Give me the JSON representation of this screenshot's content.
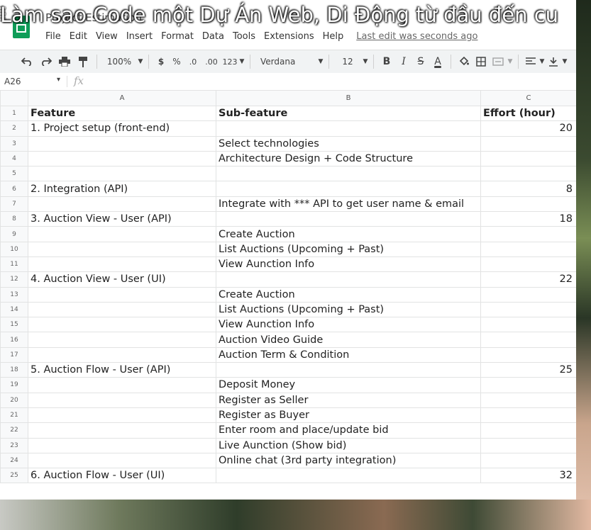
{
  "video": {
    "title": "Làm sao Code một Dự Án Web, Di Động từ đầu đến cu"
  },
  "doc": {
    "title": "Project Estimation"
  },
  "menu": [
    "File",
    "Edit",
    "View",
    "Insert",
    "Format",
    "Data",
    "Tools",
    "Extensions",
    "Help"
  ],
  "last_edit": "Last edit was seconds ago",
  "toolbar": {
    "zoom": "100%",
    "currency": "$",
    "percent": "%",
    "dec_less": ".0",
    "dec_more": ".00",
    "number_format": "123",
    "font": "Verdana",
    "font_size": "12",
    "bold": "B",
    "italic": "I",
    "strike": "S",
    "text_color": "A"
  },
  "formula_bar": {
    "cell_ref": "A26",
    "fx": "fx"
  },
  "columns": [
    "A",
    "B",
    "C"
  ],
  "rows": [
    {
      "n": "1",
      "a": "Feature",
      "b": "Sub-feature",
      "c": "Effort (hour)"
    },
    {
      "n": "2",
      "a": "1. Project setup (front-end)",
      "b": "",
      "c": "20"
    },
    {
      "n": "3",
      "a": "",
      "b": "Select technologies",
      "c": ""
    },
    {
      "n": "4",
      "a": "",
      "b": "Architecture Design + Code Structure",
      "c": ""
    },
    {
      "n": "5",
      "a": "",
      "b": "",
      "c": ""
    },
    {
      "n": "6",
      "a": "2. Integration (API)",
      "b": "",
      "c": "8"
    },
    {
      "n": "7",
      "a": "",
      "b": "Integrate with *** API to get user name & email",
      "c": ""
    },
    {
      "n": "8",
      "a": "3. Auction View - User (API)",
      "b": "",
      "c": "18"
    },
    {
      "n": "9",
      "a": "",
      "b": "Create Auction",
      "c": ""
    },
    {
      "n": "10",
      "a": "",
      "b": "List Auctions (Upcoming + Past)",
      "c": ""
    },
    {
      "n": "11",
      "a": "",
      "b": "View Aunction Info",
      "c": ""
    },
    {
      "n": "12",
      "a": "4. Auction View - User (UI)",
      "b": "",
      "c": "22"
    },
    {
      "n": "13",
      "a": "",
      "b": "Create Auction",
      "c": ""
    },
    {
      "n": "14",
      "a": "",
      "b": "List Auctions (Upcoming + Past)",
      "c": ""
    },
    {
      "n": "15",
      "a": "",
      "b": "View Aunction Info",
      "c": ""
    },
    {
      "n": "16",
      "a": "",
      "b": "Auction Video Guide",
      "c": ""
    },
    {
      "n": "17",
      "a": "",
      "b": "Auction Term & Condition",
      "c": ""
    },
    {
      "n": "18",
      "a": "5. Auction Flow - User (API)",
      "b": "",
      "c": "25"
    },
    {
      "n": "19",
      "a": "",
      "b": "Deposit Money",
      "c": ""
    },
    {
      "n": "20",
      "a": "",
      "b": "Register as Seller",
      "c": ""
    },
    {
      "n": "21",
      "a": "",
      "b": "Register as Buyer",
      "c": ""
    },
    {
      "n": "22",
      "a": "",
      "b": "Enter room and place/update bid",
      "c": ""
    },
    {
      "n": "23",
      "a": "",
      "b": "Live Aunction (Show bid)",
      "c": ""
    },
    {
      "n": "24",
      "a": "",
      "b": "Online chat (3rd party integration)",
      "c": ""
    },
    {
      "n": "25",
      "a": "6. Auction Flow - User (UI)",
      "b": "",
      "c": "32"
    }
  ],
  "colors": {
    "sheets_green": "#0f9d58",
    "grid_line": "#e2e3e3",
    "header_bg": "#f8f9fa"
  }
}
